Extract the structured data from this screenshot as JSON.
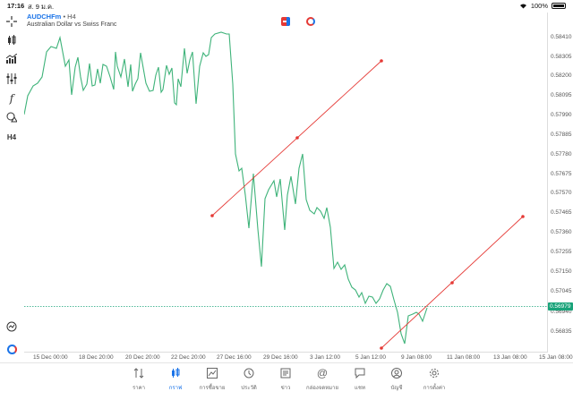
{
  "status_bar": {
    "time": "17:16",
    "date": "ส. 9 ม.ค.",
    "battery": "100%"
  },
  "chart": {
    "symbol": "AUDCHFm",
    "timeframe": "• H4",
    "description": "Australian Dollar vs Swiss Franc",
    "current_price": "0.56979",
    "line_color": "#3fb37a",
    "trendline_color": "#e53935"
  },
  "left_toolbar": {
    "tools": [
      "crosshair-icon",
      "candlestick-icon",
      "indicator-icon",
      "settings-sliders-icon",
      "function-icon",
      "shapes-icon",
      "timeframe-h4"
    ],
    "timeframe_label": "H4"
  },
  "price_axis": [
    "0.58410",
    "0.58305",
    "0.58200",
    "0.58095",
    "0.57990",
    "0.57885",
    "0.57780",
    "0.57675",
    "0.57570",
    "0.57465",
    "0.57360",
    "0.57255",
    "0.57150",
    "0.57045",
    "0.56940",
    "0.56835"
  ],
  "time_axis": [
    "15 Dec 00:00",
    "18 Dec 20:00",
    "20 Dec 20:00",
    "22 Dec 20:00",
    "27 Dec 16:00",
    "29 Dec 16:00",
    "3 Jan 12:00",
    "5 Jan 12:00",
    "9 Jan 08:00",
    "11 Jan 08:00",
    "13 Jan 08:00",
    "15 Jan 08:00"
  ],
  "bottom_nav": [
    {
      "label": "ราคา",
      "icon": "quotes-icon",
      "active": false
    },
    {
      "label": "กราฟ",
      "icon": "chart-icon",
      "active": true
    },
    {
      "label": "การซื้อขาย",
      "icon": "trade-icon",
      "active": false
    },
    {
      "label": "ประวัติ",
      "icon": "history-icon",
      "active": false
    },
    {
      "label": "ข่าว",
      "icon": "news-icon",
      "active": false
    },
    {
      "label": "กล่องจดหมาย",
      "icon": "mailbox-icon",
      "active": false
    },
    {
      "label": "แชท",
      "icon": "chat-icon",
      "active": false
    },
    {
      "label": "บัญชี",
      "icon": "account-icon",
      "active": false
    },
    {
      "label": "การตั้งค่า",
      "icon": "settings-icon",
      "active": false
    }
  ]
}
